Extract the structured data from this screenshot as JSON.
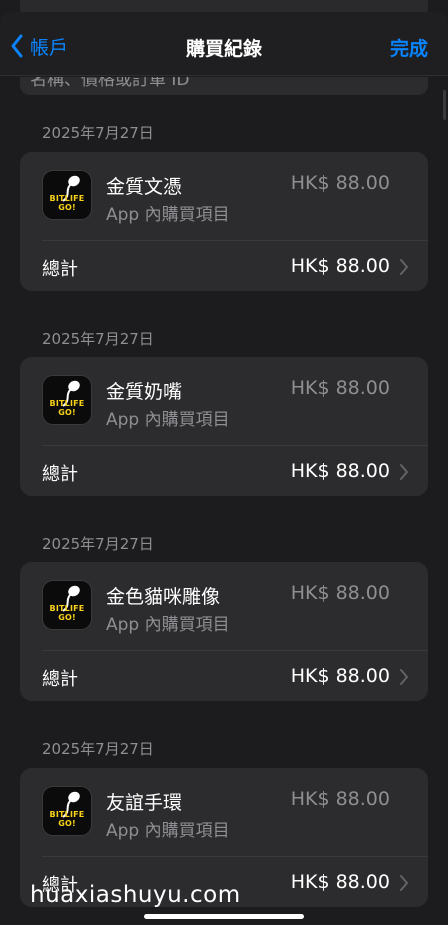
{
  "nav": {
    "back_label": "帳戶",
    "title": "購買紀錄",
    "done_label": "完成"
  },
  "search": {
    "placeholder": "名稱、價格或訂單 ID"
  },
  "purchases": [
    {
      "date": "2025年7月27日",
      "item_name": "金質文憑",
      "item_type": "App 內購買項目",
      "price": "HK$ 88.00",
      "total_label": "總計",
      "total": "HK$ 88.00",
      "app_icon_text": "BITLIFE GO!"
    },
    {
      "date": "2025年7月27日",
      "item_name": "金質奶嘴",
      "item_type": "App 內購買項目",
      "price": "HK$ 88.00",
      "total_label": "總計",
      "total": "HK$ 88.00",
      "app_icon_text": "BITLIFE GO!"
    },
    {
      "date": "2025年7月27日",
      "item_name": "金色貓咪雕像",
      "item_type": "App 內購買項目",
      "price": "HK$ 88.00",
      "total_label": "總計",
      "total": "HK$ 88.00",
      "app_icon_text": "BITLIFE GO!"
    },
    {
      "date": "2025年7月27日",
      "item_name": "友誼手環",
      "item_type": "App 內購買項目",
      "price": "HK$ 88.00",
      "total_label": "總計",
      "total": "HK$ 88.00",
      "app_icon_text": "BITLIFE GO!"
    }
  ],
  "watermark": "huaxiashuyu.com",
  "colors": {
    "accent": "#0a84ff",
    "background": "#1c1c1e",
    "card": "#2c2c2e",
    "secondary_text": "#8e8e93"
  }
}
